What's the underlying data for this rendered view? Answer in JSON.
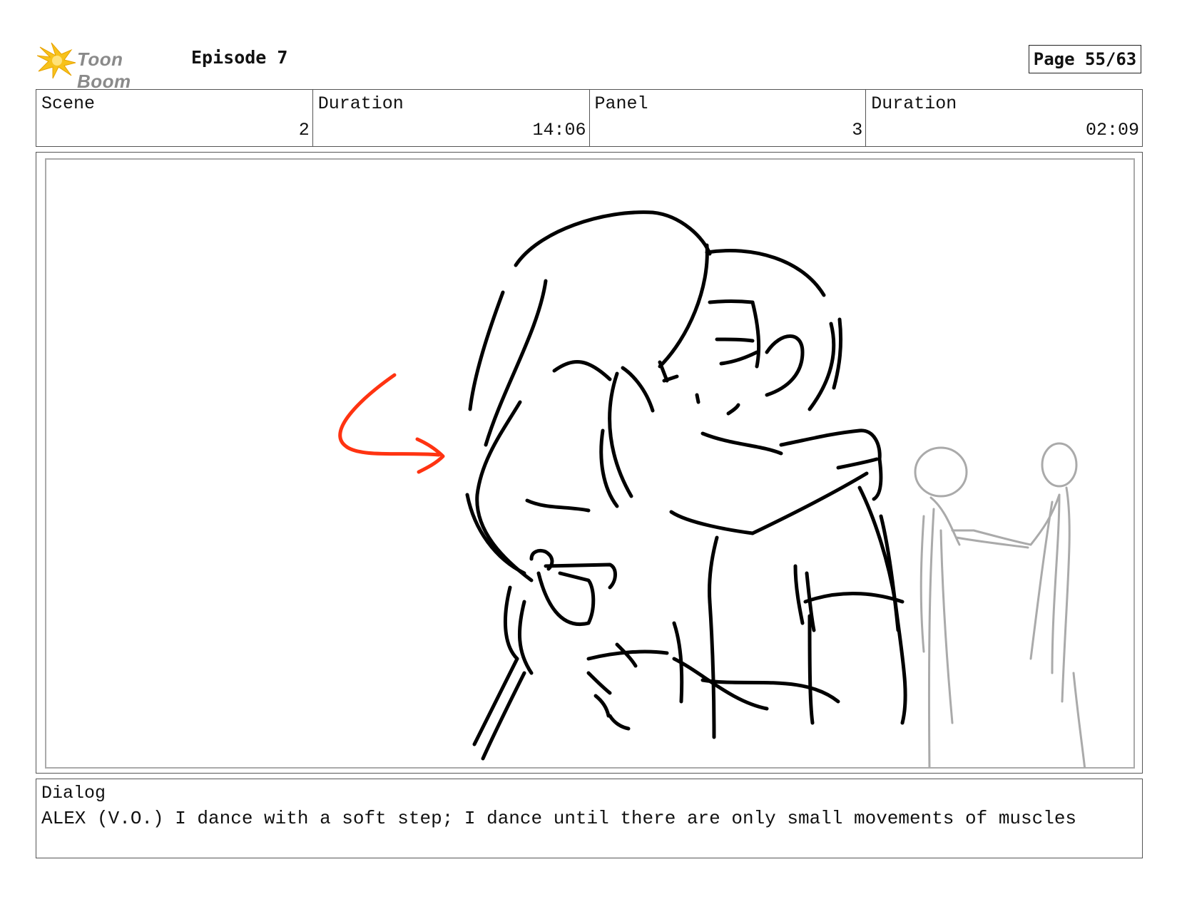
{
  "header": {
    "logo_text": "Toon Boom",
    "episode": "Episode 7",
    "page": "Page 55/63"
  },
  "meta": {
    "scene_label": "Scene",
    "scene_value": "2",
    "scene_duration_label": "Duration",
    "scene_duration_value": "14:06",
    "panel_label": "Panel",
    "panel_value": "3",
    "panel_duration_label": "Duration",
    "panel_duration_value": "02:09"
  },
  "dialog": {
    "label": "Dialog",
    "text": "ALEX (V.O.) I dance with a soft step; I dance until there are only small movements of muscles"
  },
  "colors": {
    "logo_yellow": "#f7c21b",
    "arrow_red": "#ff3311",
    "ink": "#000000",
    "background_figures": "#aaaaaa"
  }
}
